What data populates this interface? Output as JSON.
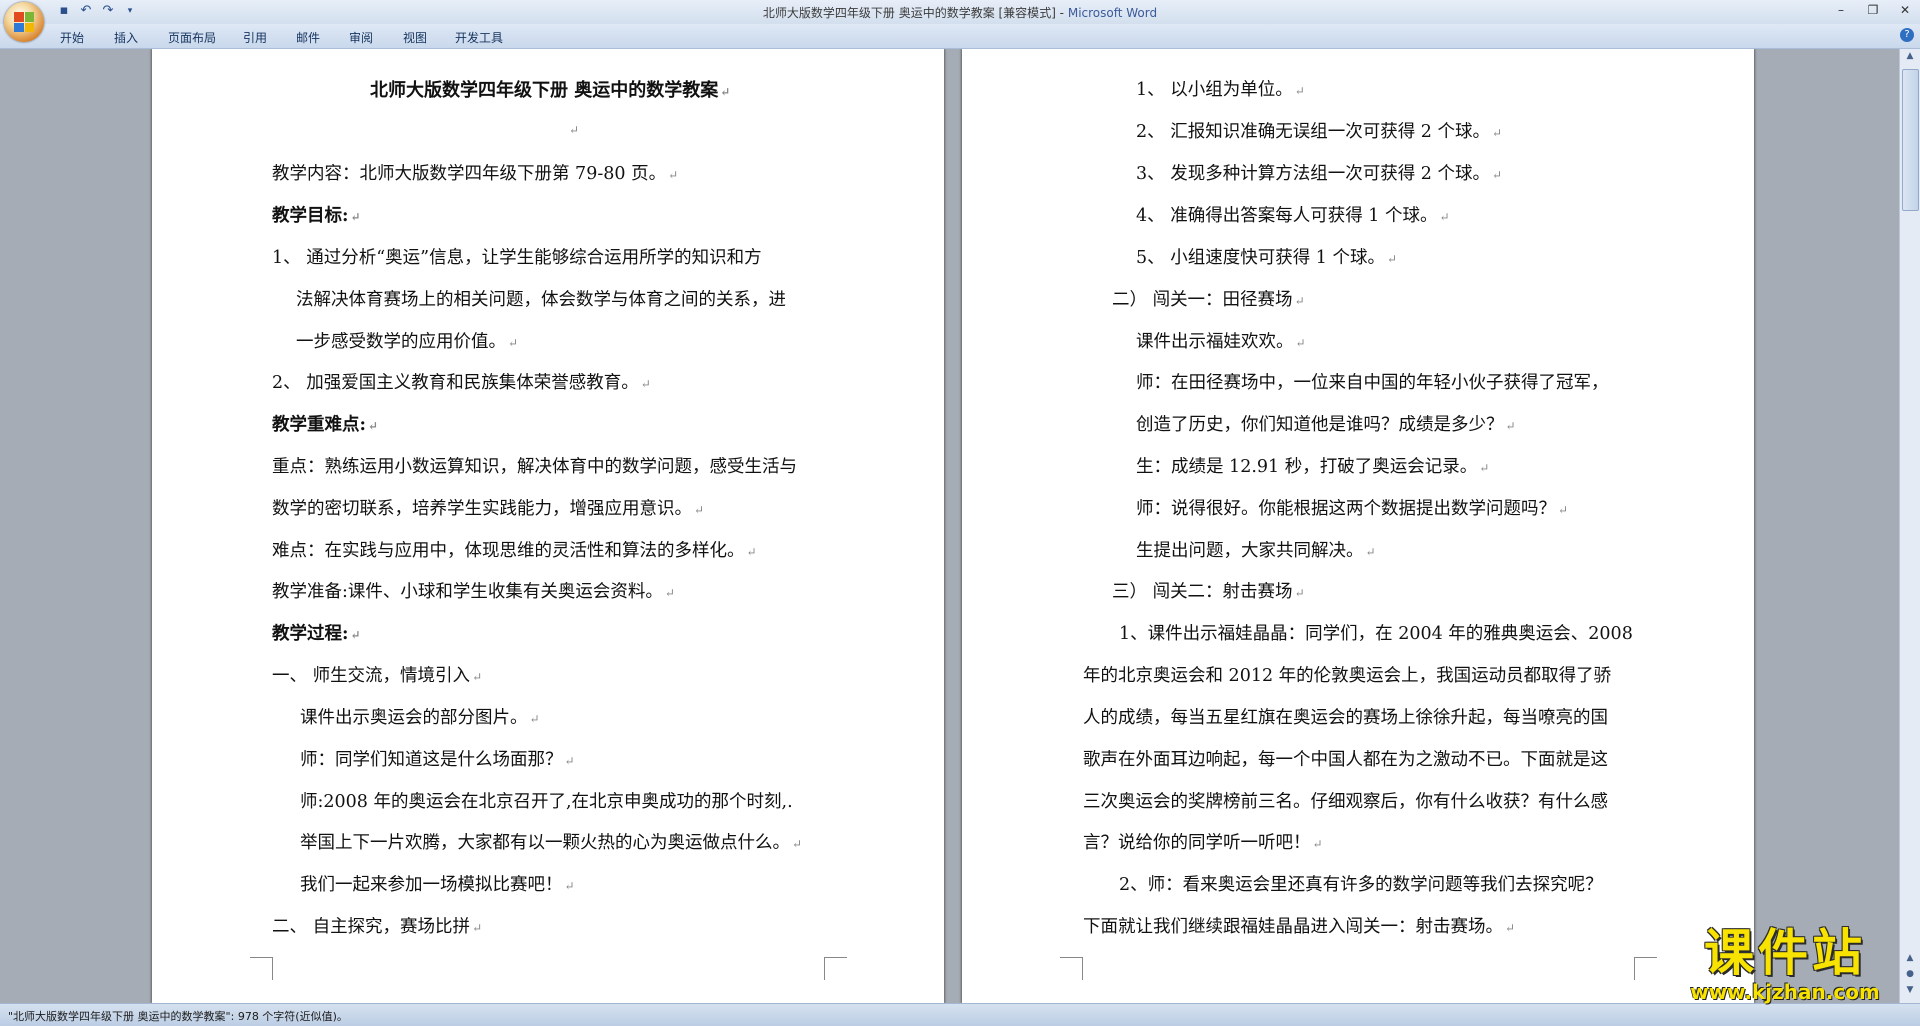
{
  "window": {
    "title": "北师大版数学四年级下册  奥运中的数学教案 [兼容模式] - ",
    "app_name": "Microsoft Word"
  },
  "ribbon": {
    "tabs": [
      "开始",
      "插入",
      "页面布局",
      "引用",
      "邮件",
      "审阅",
      "视图",
      "开发工具"
    ]
  },
  "page1": {
    "lines": [
      "北师大版数学四年级下册    奥运中的数学教案",
      "",
      "教学内容：北师大版数学四年级下册第 79-80 页。",
      "教学目标:",
      "1、     通过分析“奥运”信息，让学生能够综合运用所学的知识和方",
      "法解决体育赛场上的相关问题，体会数学与体育之间的关系，进",
      "一步感受数学的应用价值。",
      "2、     加强爱国主义教育和民族集体荣誉感教育。",
      "教学重难点:",
      "重点：熟练运用小数运算知识，解决体育中的数学问题，感受生活与",
      "数学的密切联系，培养学生实践能力，增强应用意识。",
      "难点：在实践与应用中，体现思维的灵活性和算法的多样化。",
      "教学准备:课件、小球和学生收集有关奥运会资料。",
      "教学过程:",
      "一、     师生交流，情境引入",
      "课件出示奥运会的部分图片。",
      "师：同学们知道这是什么场面那？",
      "师:2008 年的奥运会在北京召开了,在北京申奥成功的那个时刻,.",
      "举国上下一片欢腾，大家都有以一颗火热的心为奥运做点什么。",
      "我们一起来参加一场模拟比赛吧！",
      "二、     自主探究，赛场比拼"
    ]
  },
  "page2": {
    "lines": [
      "1、 以小组为单位。",
      "2、 汇报知识准确无误组一次可获得 2 个球。",
      "3、 发现多种计算方法组一次可获得 2 个球。",
      "4、 准确得出答案每人可获得 1 个球。",
      "5、 小组速度快可获得 1 个球。",
      "二）    闯关一：田径赛场",
      "课件出示福娃欢欢。",
      "师：在田径赛场中，一位来自中国的年轻小伙子获得了冠军，",
      "创造了历史，你们知道他是谁吗？成绩是多少？",
      "生：成绩是 12.91 秒，打破了奥运会记录。",
      "师：说得很好。你能根据这两个数据提出数学问题吗？",
      "生提出问题，大家共同解决。",
      "三）    闯关二：射击赛场",
      "1、课件出示福娃晶晶：同学们，在 2004 年的雅典奥运会、2008",
      "年的北京奥运会和 2012 年的伦敦奥运会上，我国运动员都取得了骄",
      "人的成绩，每当五星红旗在奥运会的赛场上徐徐升起，每当嘹亮的国",
      "歌声在外面耳边响起，每一个中国人都在为之激动不已。下面就是这",
      "三次奥运会的奖牌榜前三名。仔细观察后，你有什么收获？有什么感",
      "言？说给你的同学听一听吧！",
      "2、师：看来奥运会里还真有许多的数学问题等我们去探究呢？",
      "下面就让我们继续跟福娃晶晶进入闯关一：射击赛场。"
    ]
  },
  "statusbar": {
    "text": "\"北师大版数学四年级下册  奥运中的数学教案\": 978 个字符(近似值)。"
  },
  "watermark": {
    "big": "课件站",
    "url": "www.kjzhan.com"
  },
  "colors": {
    "title_bar": "#dbe5f1",
    "page_bg": "#ffffff",
    "workspace": "#a5acb6",
    "watermark": "#f7e200"
  }
}
